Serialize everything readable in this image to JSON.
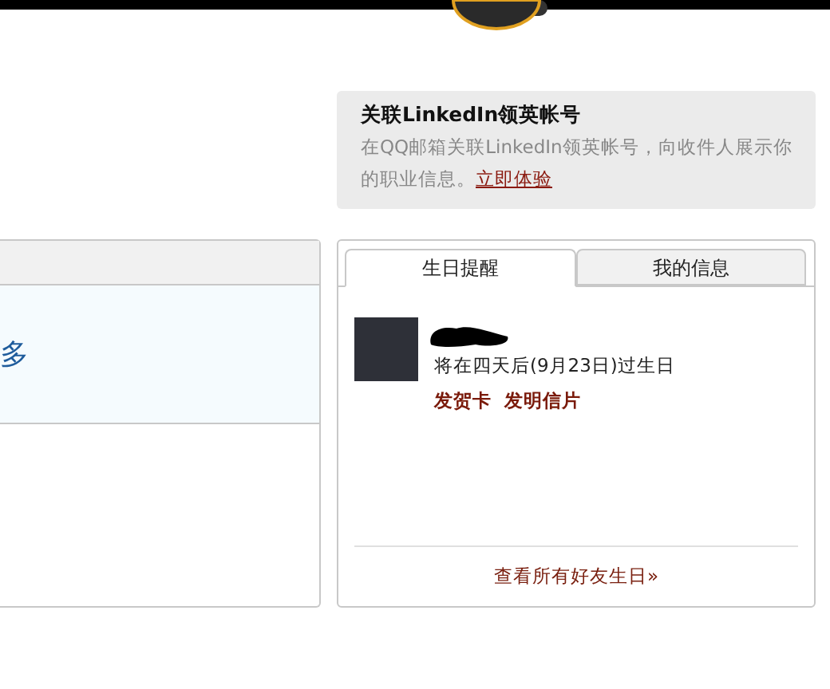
{
  "linkedin_promo": {
    "title": "关联LinkedIn领英帐号",
    "text": "在QQ邮箱关联LinkedIn领英帐号，向收件人展示你的职业信息。",
    "link": "立即体验"
  },
  "left_panel": {
    "more_link": "多"
  },
  "birthday_panel": {
    "tabs": [
      {
        "label": "生日提醒",
        "selected": true
      },
      {
        "label": "我的信息",
        "selected": false
      }
    ],
    "reminder": {
      "text": "将在四天后(9月23日)过生日",
      "actions": [
        "发贺卡",
        "发明信片"
      ]
    },
    "footer_link": "查看所有好友生日»"
  }
}
